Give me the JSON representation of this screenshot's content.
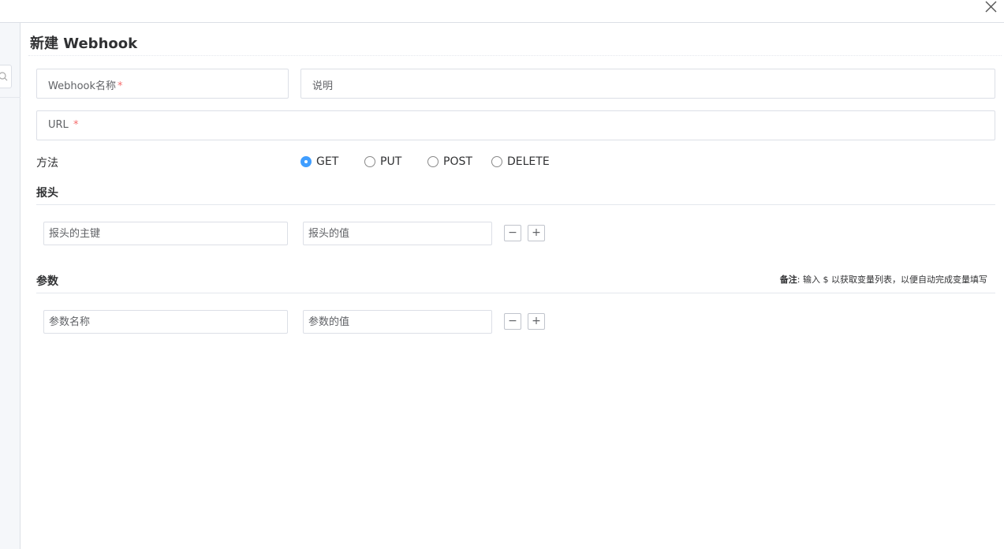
{
  "dialog": {
    "title": "新建 Webhook",
    "close_icon": "close-icon"
  },
  "form": {
    "name_label": "Webhook名称",
    "required_mark": "*",
    "description_label": "说明",
    "url_label": "URL",
    "method_label": "方法",
    "methods": [
      {
        "label": "GET",
        "checked": true
      },
      {
        "label": "PUT",
        "checked": false
      },
      {
        "label": "POST",
        "checked": false
      },
      {
        "label": "DELETE",
        "checked": false
      }
    ]
  },
  "headers": {
    "title": "报头",
    "key_placeholder": "报头的主键",
    "value_placeholder": "报头的值",
    "remove_label": "−",
    "add_label": "+"
  },
  "params": {
    "title": "参数",
    "note_prefix": "备注",
    "note_text": ": 输入 $ 以获取变量列表，以便自动完成变量填写",
    "name_placeholder": "参数名称",
    "value_placeholder": "参数的值",
    "remove_label": "−",
    "add_label": "+"
  },
  "colors": {
    "accent": "#409eff",
    "required": "#f56c6c",
    "border": "#dcdfe6"
  }
}
